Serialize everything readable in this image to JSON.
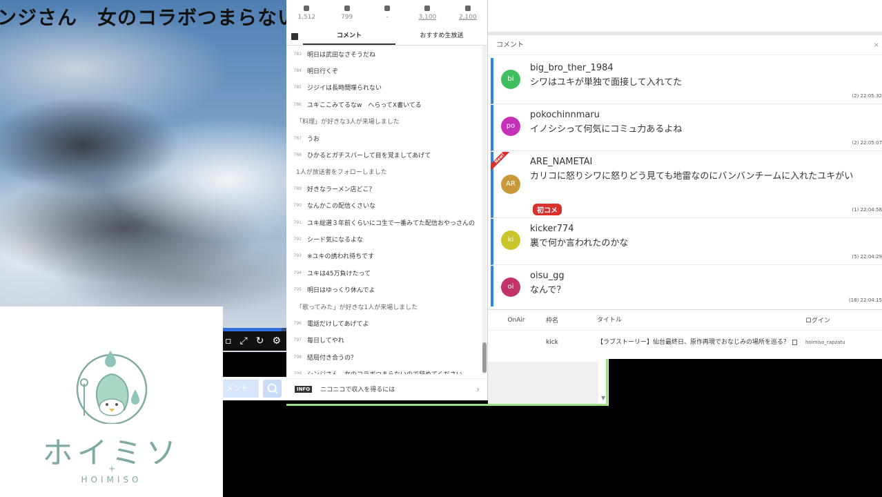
{
  "video": {
    "title": "ンジさん　女のコラボつまらない",
    "progress_fraction": 0.92
  },
  "logo": {
    "text_jp": "ホイミソ",
    "text_en": "HOIMISO",
    "plus": "+"
  },
  "send": {
    "placeholder": "メント"
  },
  "stats": [
    {
      "icon": "viewers-icon",
      "value": "1,512",
      "underline": false
    },
    {
      "icon": "comments-icon",
      "value": "799",
      "underline": false
    },
    {
      "icon": "ad-icon",
      "value": "-",
      "underline": false
    },
    {
      "icon": "gift-icon",
      "value": "3,100",
      "underline": true
    },
    {
      "icon": "present-icon",
      "value": "2,100",
      "underline": true
    }
  ],
  "nico_tabs": {
    "comments": "コメント",
    "recommended": "おすすめ生放送"
  },
  "nico_comments": [
    {
      "no": "783",
      "text": "明日は武田なさそうだね",
      "sys": false
    },
    {
      "no": "784",
      "text": "明日行くぞ",
      "sys": false
    },
    {
      "no": "785",
      "text": "ジジイは長時間喋られない",
      "sys": false
    },
    {
      "no": "786",
      "text": "ユキここみてるなw　へらってX書いてる",
      "sys": false
    },
    {
      "no": "",
      "text": "「料理」が好きな3人が来場しました",
      "sys": true
    },
    {
      "no": "787",
      "text": "うお",
      "sys": false
    },
    {
      "no": "788",
      "text": "ひかるとガチスパーして目を覚ましてあげて",
      "sys": false
    },
    {
      "no": "",
      "text": "1人が放送者をフォローしました",
      "sys": true
    },
    {
      "no": "789",
      "text": "好きなラーメン店どこ？",
      "sys": false
    },
    {
      "no": "790",
      "text": "なんかこの配信くさいな",
      "sys": false
    },
    {
      "no": "791",
      "text": "ユキ総選３年前くらいにコ生で一番みてた配信おやっさんの",
      "sys": false
    },
    {
      "no": "792",
      "text": "シード気になるよな",
      "sys": false
    },
    {
      "no": "793",
      "text": "※ユキの誘われ待ちです",
      "sys": false
    },
    {
      "no": "794",
      "text": "ユキは45万負けたって",
      "sys": false
    },
    {
      "no": "795",
      "text": "明日はゆっくり休んでよ",
      "sys": false
    },
    {
      "no": "",
      "text": "「歌ってみた」が好きな1人が来場しました",
      "sys": true
    },
    {
      "no": "796",
      "text": "電話だけしてあげてよ",
      "sys": false
    },
    {
      "no": "797",
      "text": "毎日してやれ",
      "sys": false
    },
    {
      "no": "798",
      "text": "結局付き合うの？",
      "sys": false
    },
    {
      "no": "799",
      "text": "シンジさん　女のコラボつまらないので辞めてください",
      "sys": false
    }
  ],
  "nico_info": {
    "badge": "INFO",
    "text": "ニコニコで収入を得るには",
    "chevron": "›"
  },
  "right_header": {
    "label": "コメント",
    "close": "×"
  },
  "cards": [
    {
      "initials": "bi",
      "color": "#3fbf5f",
      "user": "big_bro_ther_1984",
      "text": "シワはユキが単独で面接して入れてた",
      "meta": "(2)  22:05:32",
      "is_new": false,
      "first": ""
    },
    {
      "initials": "po",
      "color": "#c62fb8",
      "user": "pokochinnmaru",
      "text": "イノシシって何気にコミュ力あるよね",
      "meta": "(2)  22:05:07",
      "is_new": true,
      "first": ""
    },
    {
      "initials": "AR",
      "color": "#c89a3a",
      "user": "ARE_NAMETAI",
      "text": "カリコに怒りシワに怒りどう見ても地雷なのにバンバンチームに入れたユキがい",
      "meta": "(1)  22:04:58",
      "is_new": true,
      "first": "初コメ"
    },
    {
      "initials": "ki",
      "color": "#c9c42a",
      "user": "kicker774",
      "text": "裏で何か言われたのかな",
      "meta": "(5)  22:04:29",
      "is_new": false,
      "first": ""
    },
    {
      "initials": "oi",
      "color": "#c2326a",
      "user": "oisu_gg",
      "text": "なんで？",
      "meta": "(18)  22:04:15",
      "is_new": false,
      "first": ""
    }
  ],
  "new_label": "New!",
  "stream": {
    "headers": {
      "onair": "OnAir",
      "name": "枠名",
      "title": "タイトル",
      "login": "ログイン"
    },
    "row": {
      "onair": "",
      "name": "kick",
      "title": "【ラブストーリー】仙台最終日、原作再現でおなじみの場所を巡る？",
      "login": "hoimiso_rapzatu"
    }
  },
  "colors": {
    "accent_blue": "#2f86e0",
    "new_red": "#d9302b",
    "green_frame": "#9ddf8a",
    "logo_teal": "#7faaa2"
  }
}
